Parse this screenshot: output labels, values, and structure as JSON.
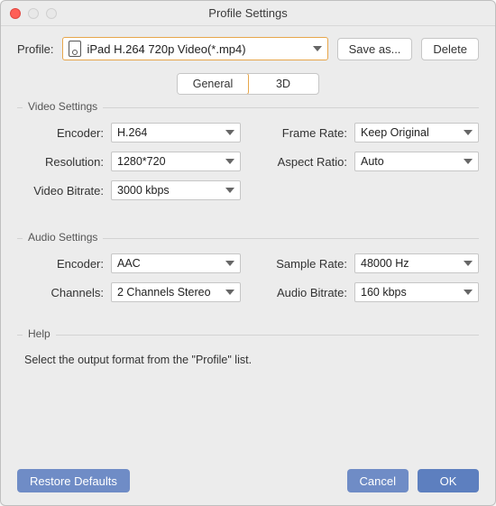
{
  "window": {
    "title": "Profile Settings"
  },
  "profile": {
    "label": "Profile:",
    "selected": "iPad H.264 720p Video(*.mp4)",
    "save_as": "Save as...",
    "delete": "Delete"
  },
  "tabs": {
    "general": "General",
    "threeD": "3D"
  },
  "video": {
    "group": "Video Settings",
    "encoder_label": "Encoder:",
    "encoder": "H.264",
    "frame_rate_label": "Frame Rate:",
    "frame_rate": "Keep Original",
    "resolution_label": "Resolution:",
    "resolution": "1280*720",
    "aspect_label": "Aspect Ratio:",
    "aspect": "Auto",
    "bitrate_label": "Video Bitrate:",
    "bitrate": "3000 kbps"
  },
  "audio": {
    "group": "Audio Settings",
    "encoder_label": "Encoder:",
    "encoder": "AAC",
    "sample_label": "Sample Rate:",
    "sample": "48000 Hz",
    "channels_label": "Channels:",
    "channels": "2 Channels Stereo",
    "bitrate_label": "Audio Bitrate:",
    "bitrate": "160 kbps"
  },
  "help": {
    "group": "Help",
    "text": "Select the output format from the \"Profile\" list."
  },
  "footer": {
    "restore": "Restore Defaults",
    "cancel": "Cancel",
    "ok": "OK"
  }
}
